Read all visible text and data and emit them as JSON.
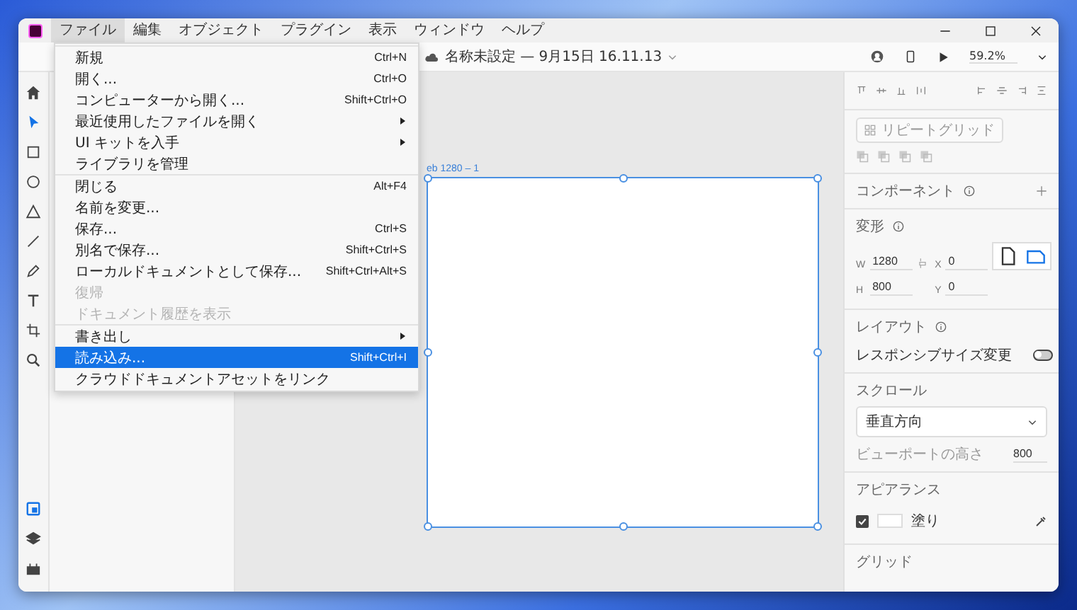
{
  "app_menu": [
    {
      "label": "ファイル",
      "selected": true
    },
    {
      "label": "編集",
      "selected": false
    },
    {
      "label": "オブジェクト",
      "selected": false
    },
    {
      "label": "プラグイン",
      "selected": false
    },
    {
      "label": "表示",
      "selected": false
    },
    {
      "label": "ウィンドウ",
      "selected": false
    },
    {
      "label": "ヘルプ",
      "selected": false
    }
  ],
  "document_title": "名称未設定 — 9月15日 16.11.13",
  "zoom": "59.2%",
  "tools": [
    {
      "kind": "home",
      "selected": false
    },
    {
      "kind": "select",
      "selected": true
    },
    {
      "kind": "rectangle",
      "selected": false
    },
    {
      "kind": "ellipse",
      "selected": false
    },
    {
      "kind": "triangle",
      "selected": false
    },
    {
      "kind": "line",
      "selected": false
    },
    {
      "kind": "pen",
      "selected": false
    },
    {
      "kind": "text",
      "selected": false
    },
    {
      "kind": "artboard",
      "selected": false
    },
    {
      "kind": "zoom",
      "selected": false
    }
  ],
  "bottom_tools": [
    {
      "kind": "assets",
      "selected": true
    },
    {
      "kind": "layers",
      "selected": false
    },
    {
      "kind": "plugins",
      "selected": false
    }
  ],
  "file_menu": {
    "sections": [
      {
        "items": [
          {
            "label": "新規",
            "shortcut": "Ctrl+N",
            "submenu": false,
            "disabled": false,
            "selected": false
          },
          {
            "label": "開く...",
            "shortcut": "Ctrl+O",
            "submenu": false,
            "disabled": false,
            "selected": false
          },
          {
            "label": "コンピューターから開く...",
            "shortcut": "Shift+Ctrl+O",
            "submenu": false,
            "disabled": false,
            "selected": false
          },
          {
            "label": "最近使用したファイルを開く",
            "submenu": true,
            "disabled": false,
            "selected": false
          },
          {
            "label": "UI キットを入手",
            "submenu": true,
            "disabled": false,
            "selected": false
          },
          {
            "label": "ライブラリを管理",
            "submenu": false,
            "disabled": false,
            "selected": false
          }
        ]
      },
      {
        "items": [
          {
            "label": "閉じる",
            "shortcut": "Alt+F4",
            "submenu": false,
            "disabled": false,
            "selected": false
          },
          {
            "label": "名前を変更...",
            "submenu": false,
            "disabled": false,
            "selected": false
          },
          {
            "label": "保存...",
            "shortcut": "Ctrl+S",
            "submenu": false,
            "disabled": false,
            "selected": false
          },
          {
            "label": "別名で保存...",
            "shortcut": "Shift+Ctrl+S",
            "submenu": false,
            "disabled": false,
            "selected": false
          },
          {
            "label": "ローカルドキュメントとして保存...",
            "shortcut": "Shift+Ctrl+Alt+S",
            "submenu": false,
            "disabled": false,
            "selected": false
          },
          {
            "label": "復帰",
            "submenu": false,
            "disabled": true,
            "selected": false
          },
          {
            "label": "ドキュメント履歴を表示",
            "submenu": false,
            "disabled": true,
            "selected": false
          }
        ]
      },
      {
        "items": [
          {
            "label": "書き出し",
            "submenu": true,
            "disabled": false,
            "selected": false
          },
          {
            "label": "読み込み...",
            "shortcut": "Shift+Ctrl+I",
            "submenu": false,
            "disabled": false,
            "selected": true
          },
          {
            "label": "クラウドドキュメントアセットをリンク",
            "submenu": false,
            "disabled": false,
            "selected": false
          }
        ]
      }
    ]
  },
  "artboard": {
    "label": "eb 1280 – 1"
  },
  "properties": {
    "repeat_grid": "リピートグリッド",
    "component": {
      "title": "コンポーネント"
    },
    "transform": {
      "title": "変形",
      "fields": [
        {
          "label": "W",
          "value": "1280"
        },
        {
          "label": "X",
          "value": "0"
        },
        {
          "label": "H",
          "value": "800"
        },
        {
          "label": "Y",
          "value": "0"
        }
      ],
      "orientations": [
        {
          "kind": "portrait",
          "selected": false
        },
        {
          "kind": "landscape",
          "selected": true
        }
      ]
    },
    "layout": {
      "title": "レイアウト",
      "responsive_label": "レスポンシブサイズ変更",
      "responsive_on": false
    },
    "scroll": {
      "title": "スクロール",
      "direction": "垂直方向",
      "viewport_label": "ビューポートの高さ",
      "viewport_value": "800"
    },
    "appearance": {
      "title": "アピアランス",
      "fill_checked": true,
      "fill_label": "塗り"
    },
    "grid": {
      "title": "グリッド"
    }
  }
}
